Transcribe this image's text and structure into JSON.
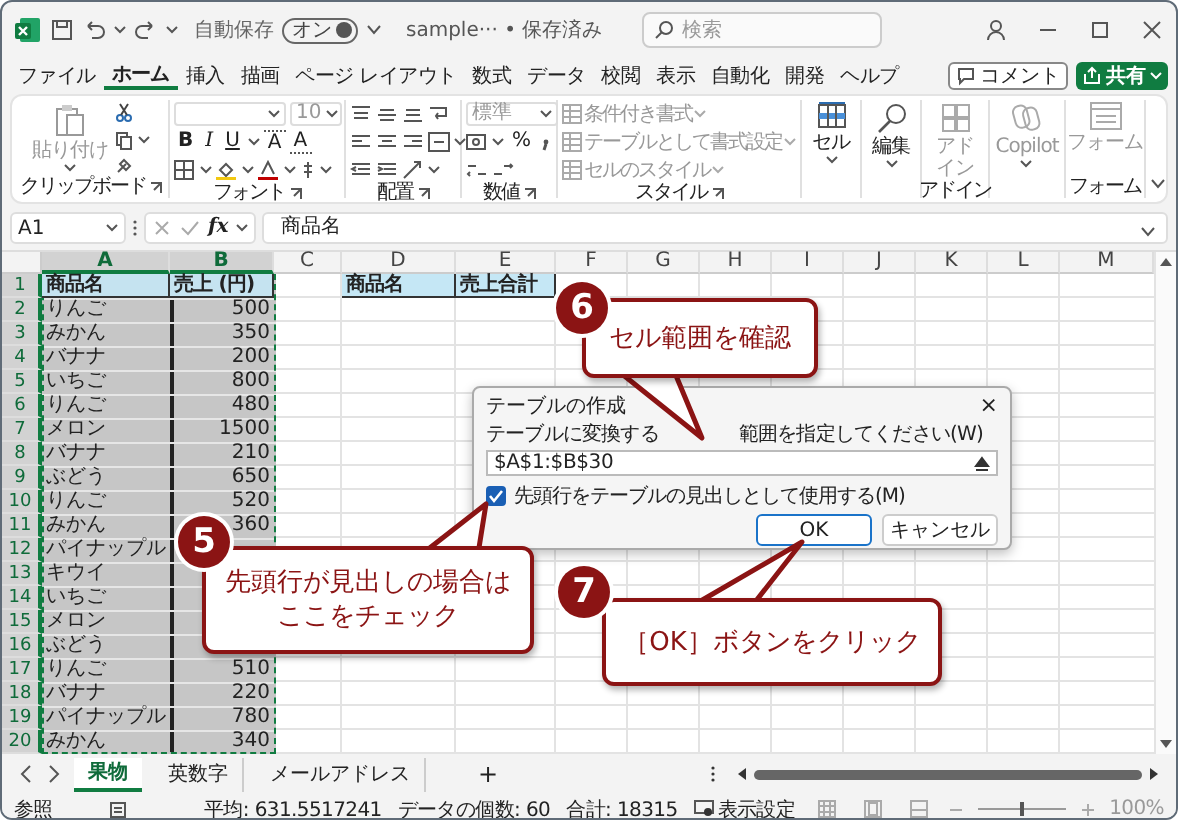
{
  "title_bar": {
    "autosave_label": "自動保存",
    "autosave": {
      "label": "オン",
      "on": true
    },
    "document": "sample··· • 保存済み",
    "search": {
      "placeholder": "検索"
    }
  },
  "menu_tabs": [
    {
      "label": "ファイル",
      "selected": false
    },
    {
      "label": "ホーム",
      "selected": true
    },
    {
      "label": "挿入",
      "selected": false
    },
    {
      "label": "描画",
      "selected": false
    },
    {
      "label": "ページ レイアウト",
      "selected": false
    },
    {
      "label": "数式",
      "selected": false
    },
    {
      "label": "データ",
      "selected": false
    },
    {
      "label": "校閲",
      "selected": false
    },
    {
      "label": "表示",
      "selected": false
    },
    {
      "label": "自動化",
      "selected": false
    },
    {
      "label": "開発",
      "selected": false
    },
    {
      "label": "ヘルプ",
      "selected": false
    }
  ],
  "comment_button": "コメント",
  "share_button": "共有",
  "ribbon": {
    "clipboard": {
      "paste": "貼り付け",
      "title": "クリップボード"
    },
    "font": {
      "size": "10",
      "bold": "B",
      "italic": "I",
      "underline": "U",
      "grow": "A",
      "shrink": "A",
      "title": "フォント"
    },
    "alignment": {
      "title": "配置"
    },
    "number": {
      "format": "標準",
      "percent": "%",
      "title": "数値"
    },
    "styles": {
      "items": [
        {
          "label": "条件付き書式",
          "disabled": true
        },
        {
          "label": "テーブルとして書式設定",
          "disabled": true
        },
        {
          "label": "セルのスタイル",
          "disabled": true
        }
      ],
      "title": "スタイル"
    },
    "cells": {
      "label": "セル",
      "disabled": false
    },
    "editing": {
      "label": "編集",
      "disabled": false
    },
    "addins": {
      "label": "アドイン",
      "disabled": true,
      "title": "アドイン"
    },
    "copilot": {
      "label": "Copilot",
      "disabled": true
    },
    "forms": {
      "label": "フォーム",
      "disabled": true,
      "title": "フォーム"
    }
  },
  "formula_bar": {
    "name_box": "A1",
    "fx": "fx",
    "content": "商品名"
  },
  "columns": [
    {
      "label": "A",
      "selected": true
    },
    {
      "label": "B",
      "selected": true
    },
    {
      "label": "C",
      "selected": false
    },
    {
      "label": "D",
      "selected": false
    },
    {
      "label": "E",
      "selected": false
    },
    {
      "label": "F",
      "selected": false
    },
    {
      "label": "G",
      "selected": false
    },
    {
      "label": "H",
      "selected": false
    },
    {
      "label": "I",
      "selected": false
    },
    {
      "label": "J",
      "selected": false
    },
    {
      "label": "K",
      "selected": false
    },
    {
      "label": "L",
      "selected": false
    },
    {
      "label": "M",
      "selected": false
    }
  ],
  "rows": [
    {
      "number": "1",
      "selected": true,
      "kind": "header",
      "cells": {
        "a": "商品名",
        "b": "売上 (円)",
        "d": "商品名",
        "e": "売上合計"
      }
    },
    {
      "number": "2",
      "selected": true,
      "kind": "data",
      "cells": {
        "a": "りんご",
        "b": "500"
      }
    },
    {
      "number": "3",
      "selected": true,
      "kind": "data",
      "cells": {
        "a": "みかん",
        "b": "350"
      }
    },
    {
      "number": "4",
      "selected": true,
      "kind": "data",
      "cells": {
        "a": "バナナ",
        "b": "200"
      }
    },
    {
      "number": "5",
      "selected": true,
      "kind": "data",
      "cells": {
        "a": "いちご",
        "b": "800"
      }
    },
    {
      "number": "6",
      "selected": true,
      "kind": "data",
      "cells": {
        "a": "りんご",
        "b": "480"
      }
    },
    {
      "number": "7",
      "selected": true,
      "kind": "data",
      "cells": {
        "a": "メロン",
        "b": "1500"
      }
    },
    {
      "number": "8",
      "selected": true,
      "kind": "data",
      "cells": {
        "a": "バナナ",
        "b": "210"
      }
    },
    {
      "number": "9",
      "selected": true,
      "kind": "data",
      "cells": {
        "a": "ぶどう",
        "b": "650"
      }
    },
    {
      "number": "10",
      "selected": true,
      "kind": "data",
      "cells": {
        "a": "りんご",
        "b": "520"
      }
    },
    {
      "number": "11",
      "selected": true,
      "kind": "data",
      "cells": {
        "a": "みかん",
        "b": "360"
      }
    },
    {
      "number": "12",
      "selected": true,
      "kind": "data",
      "cells": {
        "a": "パイナップル"
      }
    },
    {
      "number": "13",
      "selected": true,
      "kind": "data",
      "cells": {
        "a": "キウイ"
      }
    },
    {
      "number": "14",
      "selected": true,
      "kind": "data",
      "cells": {
        "a": "いちご"
      }
    },
    {
      "number": "15",
      "selected": true,
      "kind": "data",
      "cells": {
        "a": "メロン"
      }
    },
    {
      "number": "16",
      "selected": true,
      "kind": "data",
      "cells": {
        "a": "ぶどう"
      }
    },
    {
      "number": "17",
      "selected": true,
      "kind": "data",
      "cells": {
        "a": "りんご",
        "b": "510"
      }
    },
    {
      "number": "18",
      "selected": true,
      "kind": "data",
      "cells": {
        "a": "バナナ",
        "b": "220"
      }
    },
    {
      "number": "19",
      "selected": true,
      "kind": "data",
      "cells": {
        "a": "パイナップル",
        "b": "780"
      }
    },
    {
      "number": "20",
      "selected": true,
      "kind": "data",
      "cells": {
        "a": "みかん",
        "b": "340"
      }
    }
  ],
  "dialog": {
    "title": "テーブルの作成",
    "close": "×",
    "range_label_start": "テーブルに変換する",
    "range_label_end": "範囲を指定してください(W)",
    "range_value": "$A$1:$B$30",
    "header_checkbox": {
      "label": "先頭行をテーブルの見出しとして使用する(M)",
      "checked": true
    },
    "buttons": [
      {
        "label": "OK",
        "default": true
      },
      {
        "label": "キャンセル",
        "default": false
      }
    ]
  },
  "callouts": [
    {
      "number": "6",
      "lines": [
        "セル範囲を確認"
      ]
    },
    {
      "number": "5",
      "lines": [
        "先頭行が見出しの場合は",
        "ここをチェック"
      ]
    },
    {
      "number": "7",
      "lines": [
        "［OK］ボタンをクリック"
      ]
    }
  ],
  "sheet_tabs": [
    {
      "label": "果物",
      "selected": true
    },
    {
      "label": "英数字",
      "selected": false
    },
    {
      "label": "メールアドレス",
      "selected": false
    }
  ],
  "add_sheet": "+",
  "status_bar": {
    "mode": "参照",
    "average": "平均: 631.5517241",
    "count": "データの個数: 60",
    "sum": "合計: 18315",
    "display_settings": "表示設定",
    "zoom_slider": {
      "level": 0.5
    },
    "zoom": "100%"
  }
}
